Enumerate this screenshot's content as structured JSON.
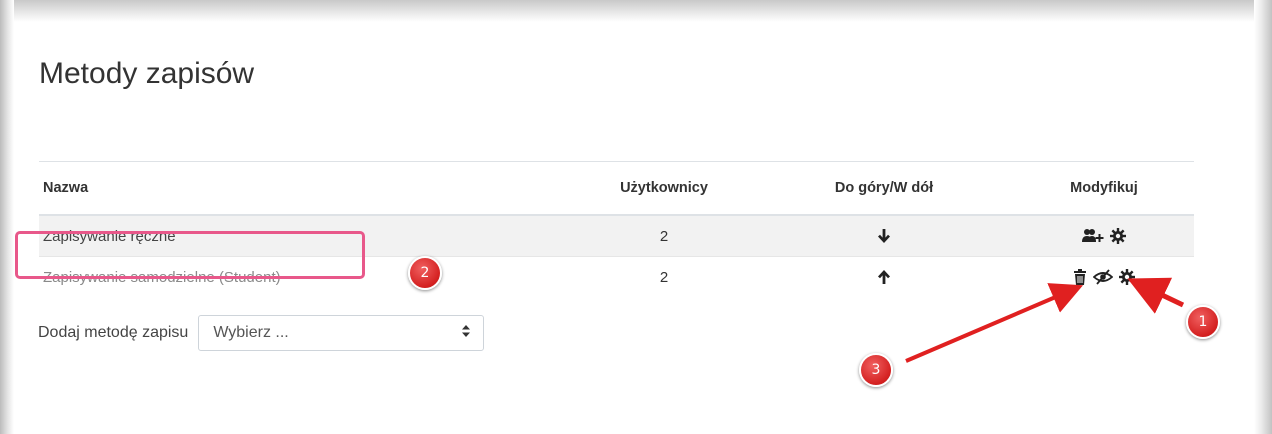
{
  "page": {
    "title": "Metody zapisów"
  },
  "table": {
    "headers": {
      "name": "Nazwa",
      "users": "Użytkownicy",
      "updown": "Do góry/W dół",
      "modify": "Modyfikuj"
    },
    "rows": [
      {
        "name": "Zapisywanie ręczne",
        "users": "2",
        "move": "down",
        "actions": [
          "enrol-users-icon",
          "gear-icon"
        ]
      },
      {
        "name": "Zapisywanie samodzielne (Student)",
        "users": "2",
        "move": "up",
        "actions": [
          "trash-icon",
          "eye-slash-icon",
          "gear-icon"
        ]
      }
    ]
  },
  "add_method": {
    "label": "Dodaj metodę zapisu",
    "select_value": "Wybierz ..."
  },
  "annotations": {
    "badge_1": "1",
    "badge_2": "2",
    "badge_3": "3",
    "color": "#e02020",
    "highlight_color": "#e8588a"
  }
}
